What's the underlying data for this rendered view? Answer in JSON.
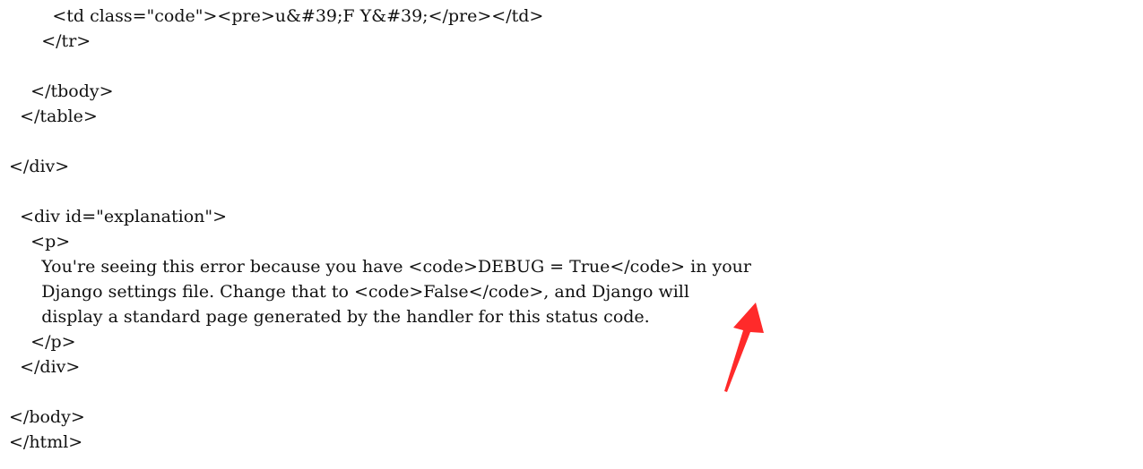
{
  "source": {
    "lines": [
      "        <td class=\"code\"><pre>u&#39;F Y&#39;</pre></td>",
      "      </tr>",
      "",
      "    </tbody>",
      "  </table>",
      "",
      "</div>",
      "",
      "  <div id=\"explanation\">",
      "    <p>",
      "      You're seeing this error because you have <code>DEBUG = True</code> in your",
      "      Django settings file. Change that to <code>False</code>, and Django will",
      "      display a standard page generated by the handler for this status code.",
      "    </p>",
      "  </div>",
      "",
      "</body>",
      "</html>"
    ]
  },
  "annotation": {
    "type": "arrow",
    "color": "#ff2a2a"
  }
}
